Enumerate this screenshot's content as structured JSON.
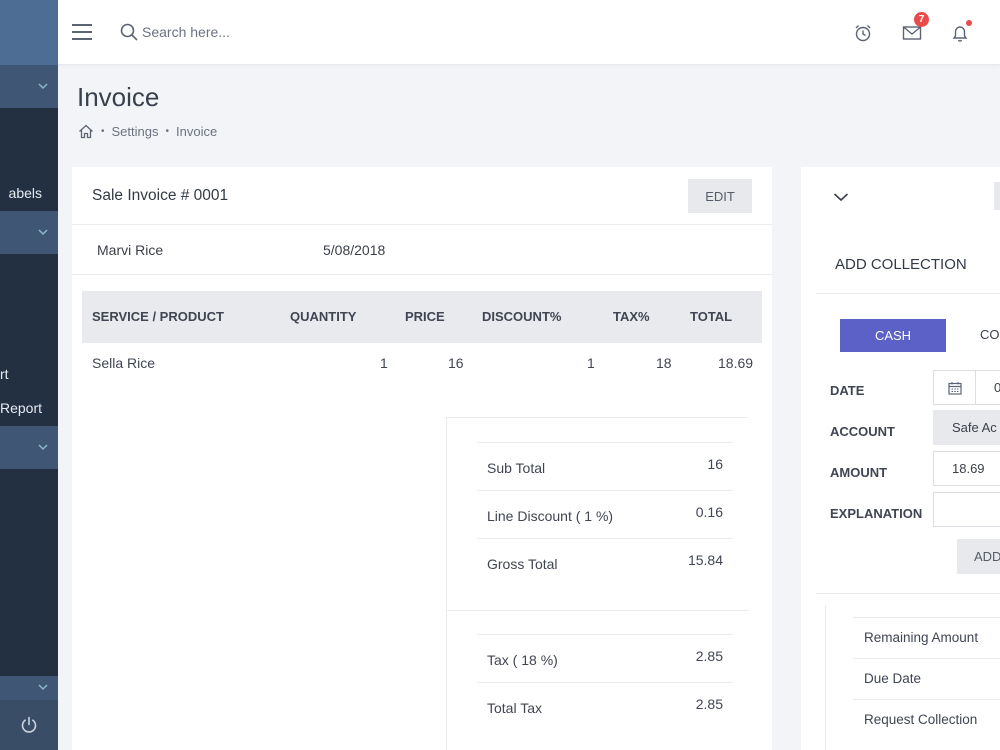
{
  "sidebar": {
    "items": [
      {
        "label": "abels"
      },
      {
        "label": "rt"
      },
      {
        "label": "Report"
      }
    ]
  },
  "topbar": {
    "search_placeholder": "Search here...",
    "mail_badge": "7"
  },
  "page": {
    "title": "Invoice",
    "breadcrumb": [
      "Settings",
      "Invoice"
    ]
  },
  "invoice": {
    "title": "Sale Invoice # 0001",
    "edit_label": "EDIT",
    "customer": "Marvi Rice",
    "date": "5/08/2018",
    "columns": [
      "SERVICE / PRODUCT",
      "QUANTITY",
      "PRICE",
      "DISCOUNT%",
      "TAX%",
      "TOTAL"
    ],
    "rows": [
      {
        "product": "Sella Rice",
        "quantity": "1",
        "price": "16",
        "discount": "1",
        "tax": "18",
        "total": "18.69"
      }
    ],
    "totals": [
      {
        "label": "Sub Total",
        "value": "16"
      },
      {
        "label": "Line Discount ( 1 %)",
        "value": "0.16"
      },
      {
        "label": "Gross Total",
        "value": "15.84"
      },
      {
        "label": "Tax ( 18 %)",
        "value": "2.85"
      },
      {
        "label": "Total Tax",
        "value": "2.85"
      }
    ]
  },
  "collection": {
    "title": "ADD COLLECTION",
    "tabs": [
      "CASH",
      "CO"
    ],
    "fields": {
      "date_label": "DATE",
      "date_value": "0",
      "account_label": "ACCOUNT",
      "account_value": "Safe Ac",
      "amount_label": "AMOUNT",
      "amount_value": "18.69",
      "explanation_label": "EXPLANATION",
      "explanation_value": ""
    },
    "add_label": "ADD",
    "info": [
      "Remaining Amount",
      "Due Date",
      "Request Collection"
    ]
  },
  "colors": {
    "sidebar_bg": "#233041",
    "sidebar_band": "#3f5775",
    "accent": "#5b61c6",
    "badge": "#e94b4b"
  },
  "icons": [
    "menu-icon",
    "search-icon",
    "alarm-clock-icon",
    "mail-icon",
    "bell-icon",
    "home-icon",
    "chevron-down-icon",
    "calendar-icon",
    "power-icon"
  ]
}
